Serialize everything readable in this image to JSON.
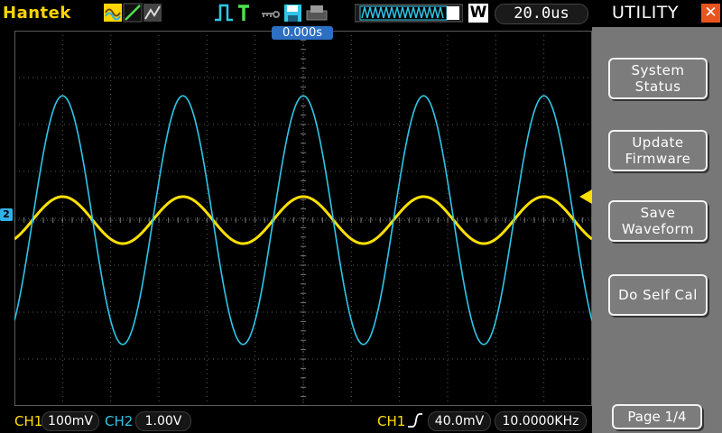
{
  "brand": "Hantek",
  "timebase": "20.0us",
  "window_mode_icon": "W",
  "trigger_position": "0.000s",
  "sidebar": {
    "title": "UTILITY",
    "close_icon": "close-icon",
    "buttons": [
      {
        "line1": "System",
        "line2": "Status"
      },
      {
        "line1": "Update",
        "line2": "Firmware"
      },
      {
        "line1": "Save",
        "line2": "Waveform"
      },
      {
        "line1": "Do Self Cal",
        "line2": ""
      }
    ],
    "page": "Page 1/4"
  },
  "channel_marker": "2",
  "bottom": {
    "ch1_label": "CH1",
    "ch1_scale": "100mV",
    "ch2_label": "CH2",
    "ch2_scale": "1.00V",
    "trig_source": "CH1",
    "trig_level": "40.0mV",
    "frequency": "10.0000KHz"
  },
  "colors": {
    "ch1": "#ffe000",
    "ch2": "#2fc6e8",
    "accent": "#e9541e"
  },
  "chart_data": {
    "type": "line",
    "series": [
      {
        "name": "CH1",
        "amplitude_div": 0.5,
        "offset_div": 0.0,
        "period_div": 2.5,
        "phase_deg": 0
      },
      {
        "name": "CH2",
        "amplitude_div": 2.65,
        "offset_div": 0.0,
        "period_div": 2.5,
        "phase_deg": 0
      }
    ],
    "grid": {
      "cols": 12,
      "rows": 8
    }
  }
}
